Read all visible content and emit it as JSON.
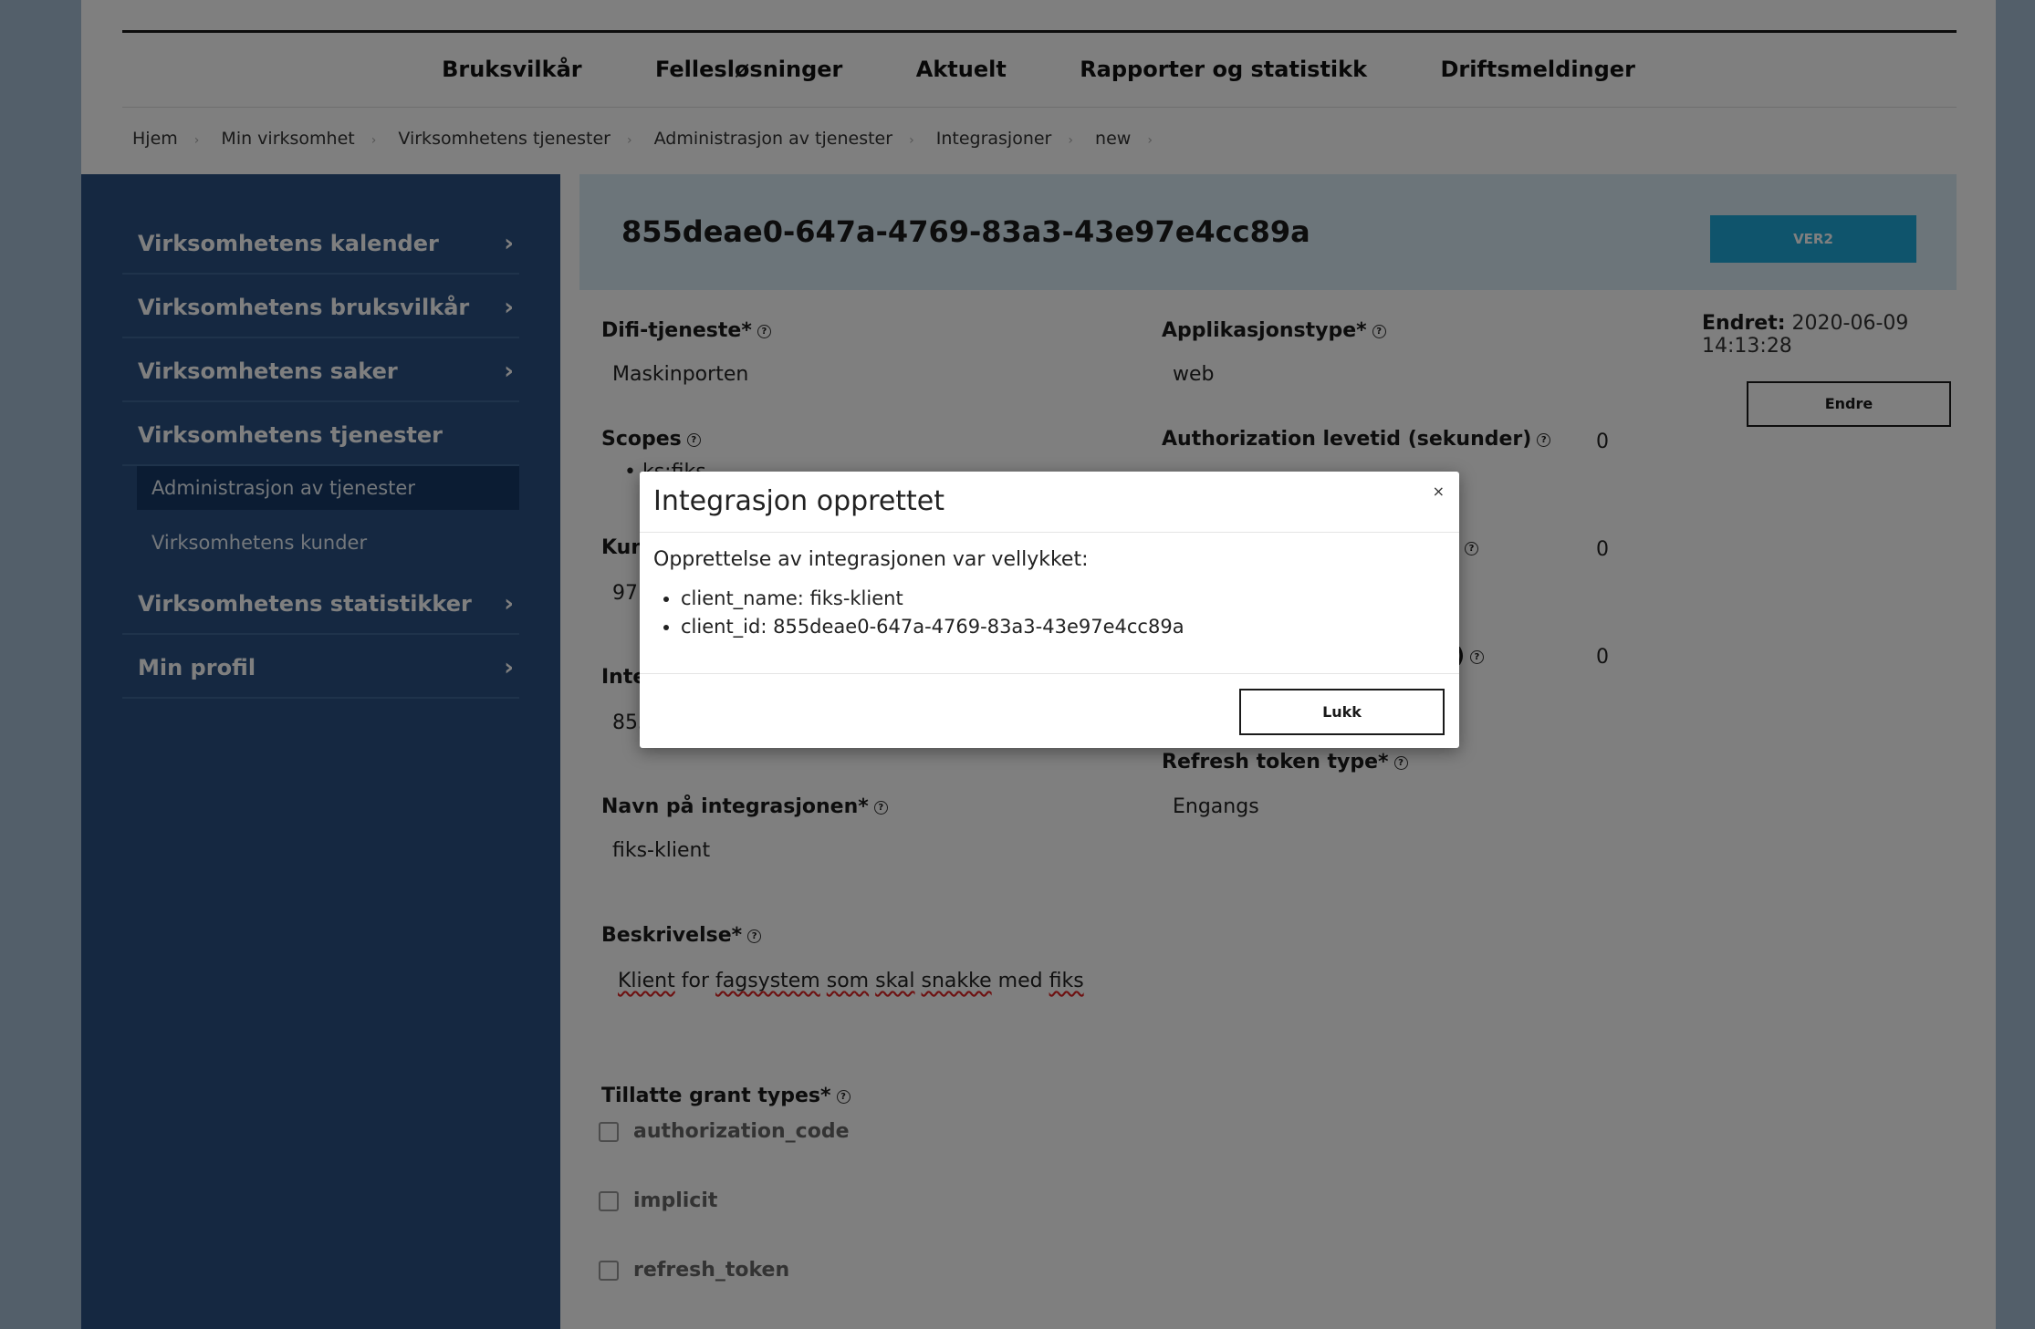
{
  "nav": [
    "Bruksvilkår",
    "Fellesløsninger",
    "Aktuelt",
    "Rapporter og statistikk",
    "Driftsmeldinger"
  ],
  "breadcrumb": [
    "Hjem",
    "Min virksomhet",
    "Virksomhetens tjenester",
    "Administrasjon av tjenester",
    "Integrasjoner",
    "new"
  ],
  "sidebar": {
    "items": [
      {
        "label": "Virksomhetens kalender",
        "chevron": "›"
      },
      {
        "label": "Virksomhetens bruksvilkår",
        "chevron": "›"
      },
      {
        "label": "Virksomhetens saker",
        "chevron": "›"
      },
      {
        "label": "Virksomhetens tjenester"
      },
      {
        "label": "Virksomhetens statistikker",
        "chevron": "›"
      },
      {
        "label": "Min profil",
        "chevron": "›"
      }
    ],
    "subitems": [
      "Administrasjon av tjenester",
      "Virksomhetens kunder"
    ]
  },
  "header": {
    "title": "855deae0-647a-4769-83a3-43e97e4cc89a",
    "version": "VER2"
  },
  "form": {
    "difi_label": "Difi-tjeneste*",
    "difi_value": "Maskinporten",
    "apptype_label": "Applikasjonstype*",
    "apptype_value": "web",
    "scopes_label": "Scopes",
    "scopes_value": "ks:fiks",
    "auth_label": "Authorization levetid (sekunder)",
    "auth_value": "0",
    "kunde_label": "Kunde",
    "kunde_value": "971",
    "field2_suffix": ")",
    "field2_value": "0",
    "integ_label": "Integrasjonens ID",
    "integ_value": "855",
    "field3_suffix": "r)",
    "field3_value": "0",
    "refresh_label": "Refresh token type*",
    "refresh_value": "Engangs",
    "navn_label": "Navn på integrasjonen*",
    "navn_value": "fiks-klient",
    "beskrivelse_label": "Beskrivelse*",
    "beskrivelse_words": [
      "Klient",
      "for",
      "fagsystem",
      "som",
      "skal",
      "snakke",
      "med",
      "fiks"
    ],
    "grant_label": "Tillatte grant types*",
    "grants": [
      "authorization_code",
      "implicit",
      "refresh_token"
    ],
    "endret_label": "Endret:",
    "endret_value": "2020-06-09 14:13:28",
    "endre_button": "Endre",
    "help_glyph": "?"
  },
  "modal": {
    "title": "Integrasjon opprettet",
    "close": "×",
    "message": "Opprettelse av integrasjonen var vellykket:",
    "items": [
      "client_name: fiks-klient",
      "client_id: 855deae0-647a-4769-83a3-43e97e4cc89a"
    ],
    "button": "Lukk"
  },
  "colors": {
    "sidebar": "#2a5182",
    "sidebar_active": "#163966",
    "header_bg": "#d9eaf5",
    "accent": "#1fa8d9",
    "page_bg": "#a7bed5"
  }
}
